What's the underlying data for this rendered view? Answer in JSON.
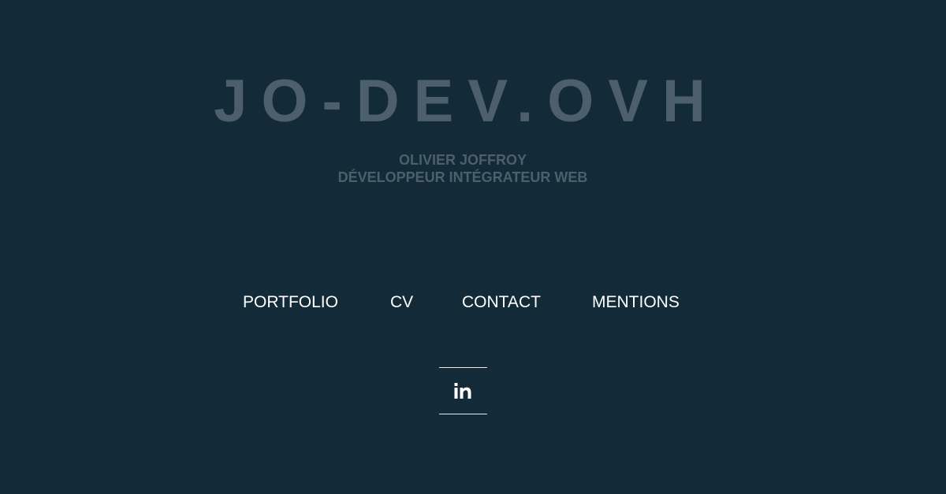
{
  "header": {
    "site_title": "JO-DEV.OVH",
    "name": "OLIVIER JOFFROY",
    "role": "DÉVELOPPEUR INTÉGRATEUR WEB"
  },
  "nav": {
    "items": [
      {
        "label": "PORTFOLIO"
      },
      {
        "label": "CV"
      },
      {
        "label": "CONTACT"
      },
      {
        "label": "MENTIONS"
      }
    ]
  },
  "social": {
    "linkedin_icon": "linkedin-icon"
  },
  "colors": {
    "background": "#132a38",
    "title": "#4c5f6a",
    "nav_text": "#ffffff"
  }
}
